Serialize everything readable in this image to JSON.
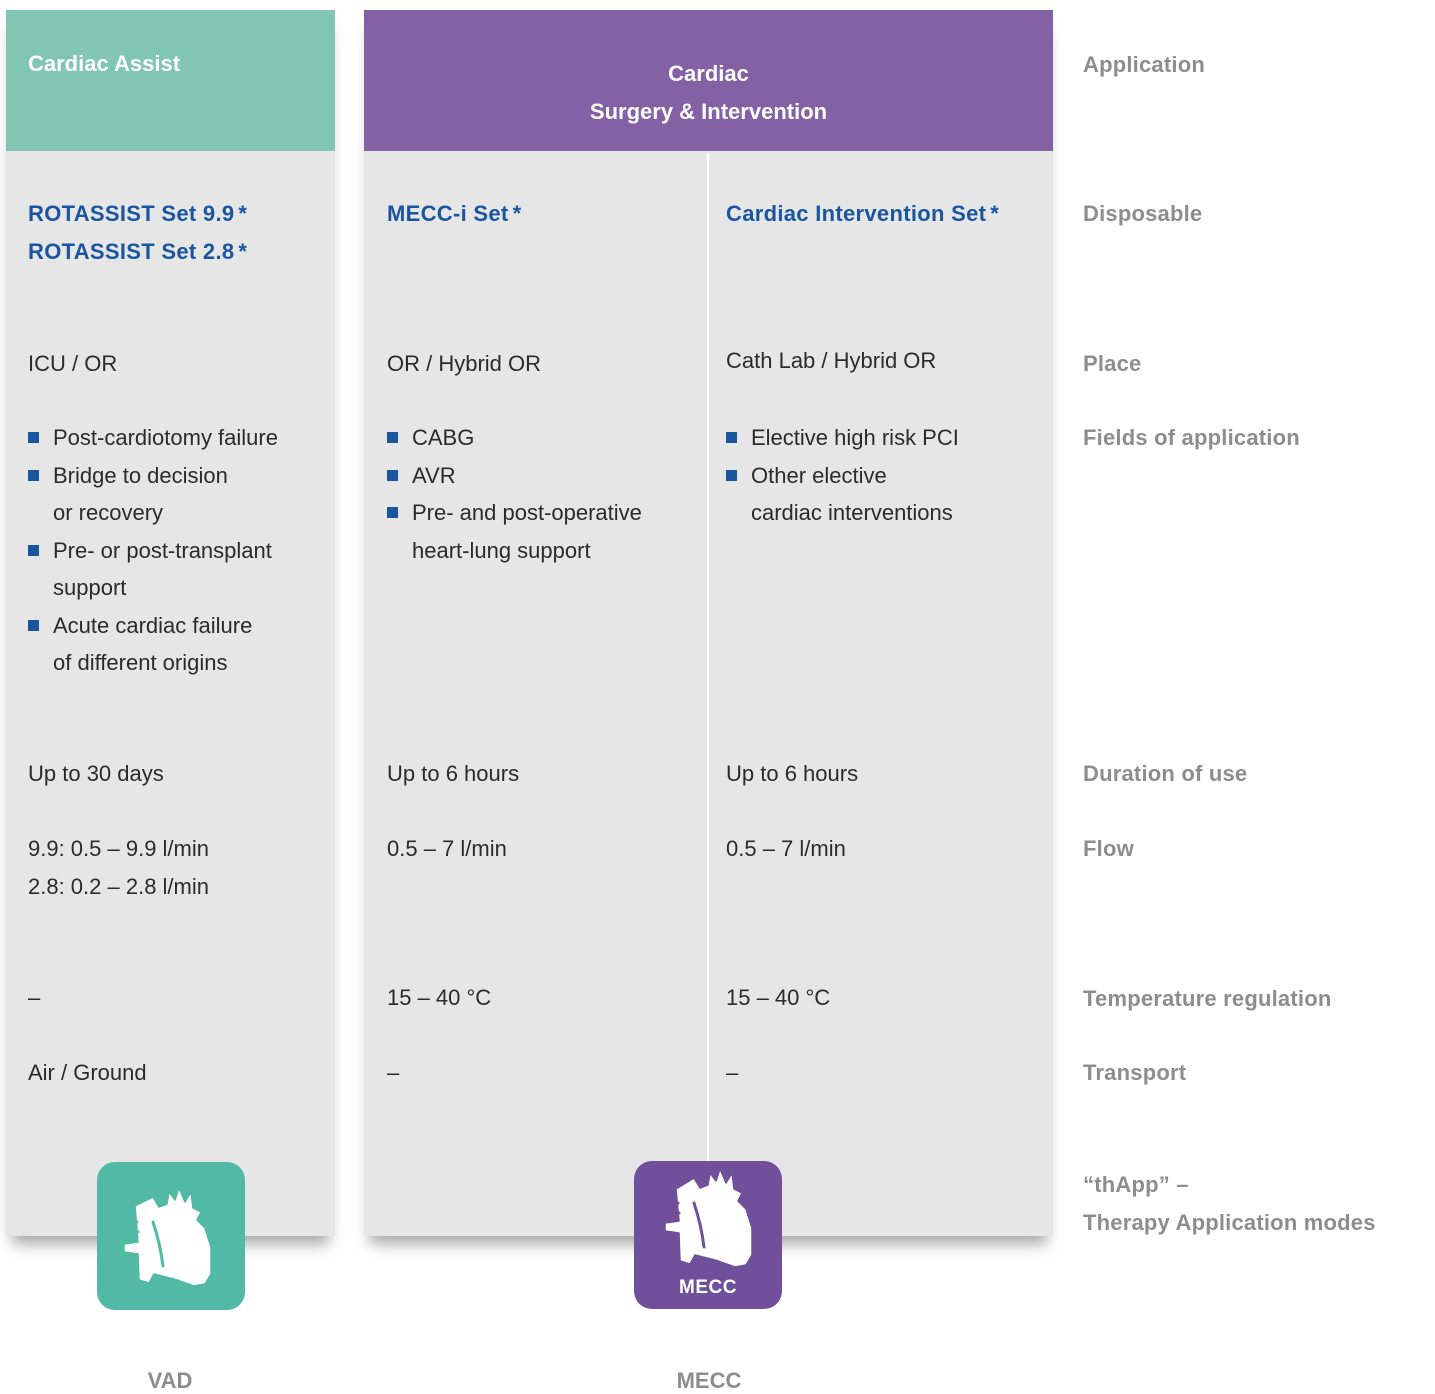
{
  "columns": [
    {
      "header": "Cardiac Assist",
      "disposable": [
        "ROTASSIST Set 9.9",
        "ROTASSIST Set 2.8"
      ],
      "place": "ICU / OR",
      "fields": [
        "Post-cardiotomy failure",
        "Bridge to decision",
        "or recovery",
        "Pre- or post-transplant",
        "support",
        "Acute cardiac failure",
        "of different origins"
      ],
      "duration": "Up to 30 days",
      "flow": [
        "9.9: 0.5 – 9.9 l/min",
        "2.8: 0.2 – 2.8 l/min"
      ],
      "temperature": "–",
      "transport": "Air / Ground",
      "icon": "heart-icon",
      "icon_color": "#52b9a6",
      "mode": "VAD"
    },
    {
      "header_line1": "Cardiac",
      "header_line2": "Surgery & Intervention",
      "sub": [
        {
          "disposable": "MECC-i Set",
          "place": "OR / Hybrid OR",
          "fields": [
            "CABG",
            "AVR",
            "Pre- and post-operative",
            "heart-lung support"
          ],
          "duration": "Up to 6 hours",
          "flow": "0.5 – 7 l/min",
          "temperature": "15 – 40 °C",
          "transport": "–"
        },
        {
          "disposable": "Cardiac Intervention Set",
          "place": "Cath Lab / Hybrid OR",
          "fields": [
            "Elective high risk PCI",
            "Other elective",
            "cardiac interventions"
          ],
          "duration": "Up to 6 hours",
          "flow": "0.5 – 7 l/min",
          "temperature": "15 – 40 °C",
          "transport": "–"
        }
      ],
      "icon": "heart-icon",
      "icon_color": "#70509a",
      "icon_badge": "MECC",
      "mode": "MECC"
    }
  ],
  "asterisk": "*",
  "row_labels": {
    "application": "Application",
    "disposable": "Disposable",
    "place": "Place",
    "fields": "Fields of application",
    "duration": "Duration of use",
    "flow": "Flow",
    "temperature": "Temperature regulation",
    "transport": "Transport",
    "thapp_line1": "“thApp” –",
    "thapp_line2": "Therapy Application modes"
  },
  "colors": {
    "assist_header": "#81c6b3",
    "surgery_header": "#8460a4",
    "panel_bg": "#e6e6e6",
    "disposable_text": "#1a56a0",
    "label_text": "#8d8d8d"
  }
}
